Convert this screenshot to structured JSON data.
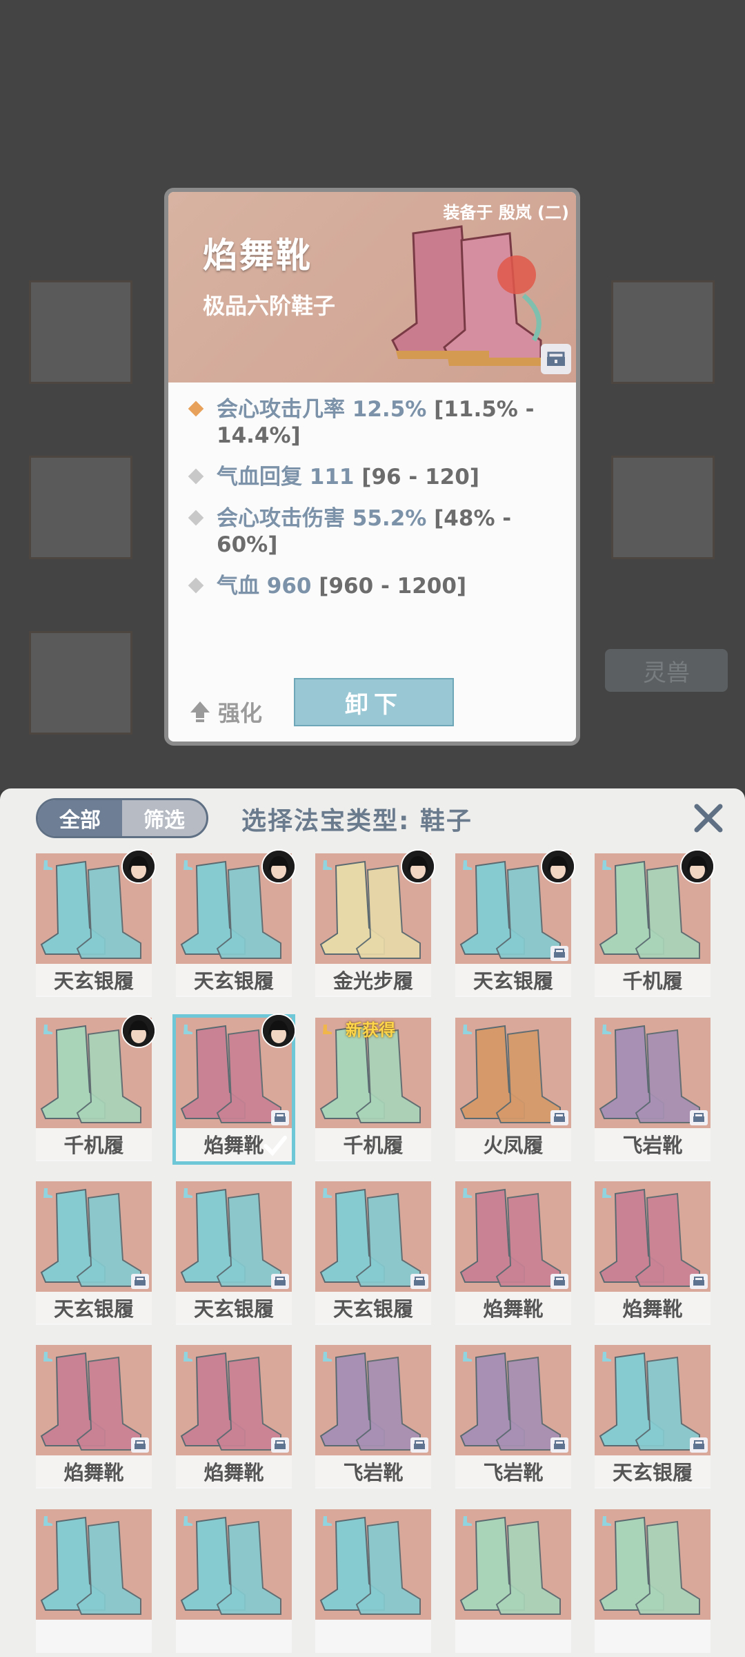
{
  "popup": {
    "equipped_to": "装备于 殷岚 (二)",
    "item_name": "焰舞靴",
    "item_grade": "极品六阶鞋子",
    "stats": [
      {
        "name": "会心攻击几率 12.5%",
        "range": " [11.5% - 14.4%]",
        "diamond_color": "#e8a15a"
      },
      {
        "name": "气血回复 111",
        "range": " [96 - 120]",
        "diamond_color": "#c8c8c8"
      },
      {
        "name": "会心攻击伤害 55.2%",
        "range": " [48% - 60%]",
        "diamond_color": "#c8c8c8"
      },
      {
        "name": "气血 960",
        "range": " [960 - 1200]",
        "diamond_color": "#c8c8c8"
      }
    ],
    "strengthen_label": "强化",
    "unequip_label": "卸下"
  },
  "background": {
    "beast_tab": "灵兽"
  },
  "panel": {
    "filter_all": "全部",
    "filter_screen": "筛选",
    "title": "选择法宝类型: 鞋子"
  },
  "items": [
    {
      "name": "天玄银履",
      "color": "#86cbd0",
      "avatar": true,
      "lock": false
    },
    {
      "name": "天玄银履",
      "color": "#86cbd0",
      "avatar": true,
      "lock": false
    },
    {
      "name": "金光步履",
      "color": "#e8d9a8",
      "avatar": true,
      "lock": false
    },
    {
      "name": "天玄银履",
      "color": "#86cbd0",
      "avatar": true,
      "lock": true
    },
    {
      "name": "千机履",
      "color": "#a9d4b8",
      "avatar": true,
      "lock": false
    },
    {
      "name": "千机履",
      "color": "#a9d4b8",
      "avatar": true,
      "lock": false
    },
    {
      "name": "焰舞靴",
      "color": "#c98294",
      "avatar": true,
      "lock": true,
      "selected": true
    },
    {
      "name": "千机履",
      "color": "#a9d4b8",
      "avatar": false,
      "lock": false,
      "new_label": "新获得"
    },
    {
      "name": "火凤履",
      "color": "#d69a6a",
      "avatar": false,
      "lock": true
    },
    {
      "name": "飞岩靴",
      "color": "#a890b4",
      "avatar": false,
      "lock": true
    },
    {
      "name": "天玄银履",
      "color": "#86cbd0",
      "avatar": false,
      "lock": true
    },
    {
      "name": "天玄银履",
      "color": "#86cbd0",
      "avatar": false,
      "lock": true
    },
    {
      "name": "天玄银履",
      "color": "#86cbd0",
      "avatar": false,
      "lock": true
    },
    {
      "name": "焰舞靴",
      "color": "#c98294",
      "avatar": false,
      "lock": true
    },
    {
      "name": "焰舞靴",
      "color": "#c98294",
      "avatar": false,
      "lock": true
    },
    {
      "name": "焰舞靴",
      "color": "#c98294",
      "avatar": false,
      "lock": true
    },
    {
      "name": "焰舞靴",
      "color": "#c98294",
      "avatar": false,
      "lock": true
    },
    {
      "name": "飞岩靴",
      "color": "#a890b4",
      "avatar": false,
      "lock": true
    },
    {
      "name": "飞岩靴",
      "color": "#a890b4",
      "avatar": false,
      "lock": true
    },
    {
      "name": "天玄银履",
      "color": "#86cbd0",
      "avatar": false,
      "lock": true
    },
    {
      "name": "",
      "color": "#86cbd0",
      "avatar": false,
      "lock": false
    },
    {
      "name": "",
      "color": "#86cbd0",
      "avatar": false,
      "lock": false
    },
    {
      "name": "",
      "color": "#86cbd0",
      "avatar": false,
      "lock": false
    },
    {
      "name": "",
      "color": "#a9d4b8",
      "avatar": false,
      "lock": false
    },
    {
      "name": "",
      "color": "#a9d4b8",
      "avatar": false,
      "lock": false
    }
  ]
}
